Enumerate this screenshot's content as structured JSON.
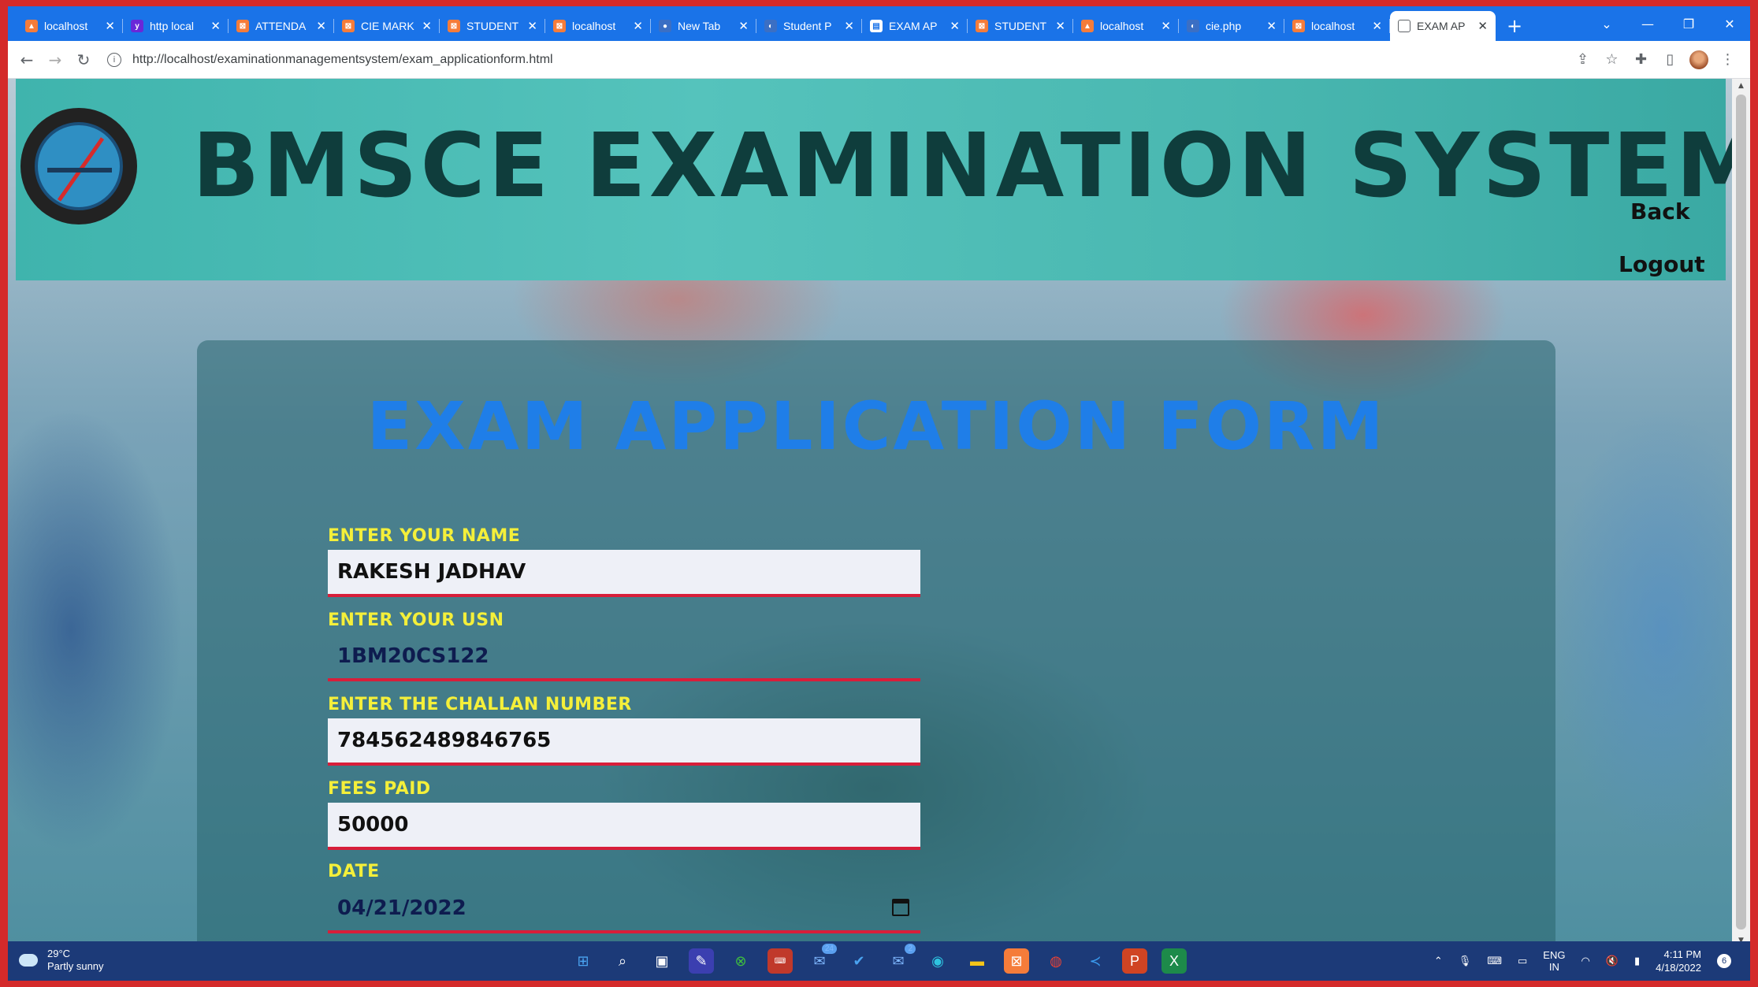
{
  "browser": {
    "tabs": [
      {
        "title": "localhost"
      },
      {
        "title": "http local"
      },
      {
        "title": "ATTENDA"
      },
      {
        "title": "CIE MARK"
      },
      {
        "title": "STUDENT"
      },
      {
        "title": "localhost"
      },
      {
        "title": "New Tab"
      },
      {
        "title": "Student P"
      },
      {
        "title": "EXAM AP"
      },
      {
        "title": "STUDENT"
      },
      {
        "title": "localhost"
      },
      {
        "title": "cie.php"
      },
      {
        "title": "localhost"
      },
      {
        "title": "EXAM AP"
      }
    ],
    "url": "http://localhost/examinationmanagementsystem/exam_applicationform.html"
  },
  "header": {
    "title": "BMSCE EXAMINATION SYSTEM",
    "back_label": "Back",
    "logout_label": "Logout"
  },
  "form": {
    "title": "EXAM APPLICATION FORM",
    "name_label": "ENTER YOUR NAME",
    "name_value": "RAKESH JADHAV",
    "usn_label": "ENTER YOUR USN",
    "usn_value": "1BM20CS122",
    "challan_label": "ENTER THE CHALLAN NUMBER",
    "challan_value": "784562489846765",
    "fees_label": "FEES PAID",
    "fees_value": "50000",
    "date_label": "DATE",
    "date_value": "04/21/2022"
  },
  "taskbar": {
    "weather_temp": "29°C",
    "weather_desc": "Partly sunny",
    "mail_badge": "24",
    "mail2_badge": "2",
    "lang_top": "ENG",
    "lang_bottom": "IN",
    "time": "4:11 PM",
    "date": "4/18/2022",
    "notifications": "6"
  }
}
